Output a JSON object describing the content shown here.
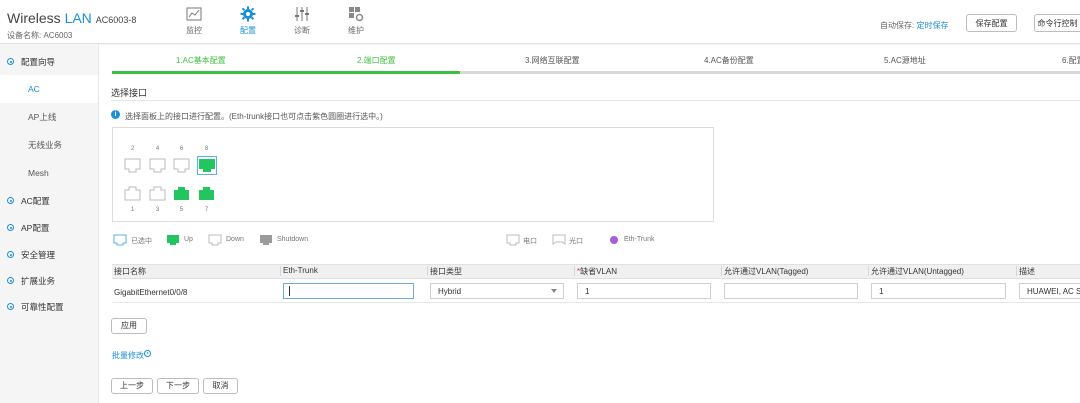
{
  "header": {
    "brand_wireless": "Wireless",
    "brand_lan": "LAN",
    "model": "AC6003-8",
    "device_label": "设备名称:",
    "device_name": "AC6003",
    "nav": [
      {
        "label": "监控",
        "icon": "monitor-chart-icon",
        "active": false
      },
      {
        "label": "配置",
        "icon": "gear-icon",
        "active": true
      },
      {
        "label": "诊断",
        "icon": "sliders-icon",
        "active": false
      },
      {
        "label": "维护",
        "icon": "maintenance-icon",
        "active": false
      }
    ],
    "autosave_label": "自动保存:",
    "autosave_link": "定时保存",
    "save_button": "保存配置",
    "cli_button": "命令行控制"
  },
  "sidebar": {
    "items": [
      {
        "label": "配置向导",
        "type": "group"
      },
      {
        "label": "AC",
        "type": "sub",
        "active": true
      },
      {
        "label": "AP上线",
        "type": "sub"
      },
      {
        "label": "无线业务",
        "type": "sub"
      },
      {
        "label": "Mesh",
        "type": "sub"
      },
      {
        "label": "AC配置",
        "type": "group"
      },
      {
        "label": "AP配置",
        "type": "group"
      },
      {
        "label": "安全管理",
        "type": "group"
      },
      {
        "label": "扩展业务",
        "type": "group"
      },
      {
        "label": "可靠性配置",
        "type": "group"
      }
    ]
  },
  "steps": [
    {
      "label": "1.AC基本配置",
      "done": true
    },
    {
      "label": "2.端口配置",
      "done": true
    },
    {
      "label": "3.网络互联配置",
      "done": false
    },
    {
      "label": "4.AC备份配置",
      "done": false
    },
    {
      "label": "5.AC源地址",
      "done": false
    },
    {
      "label": "6.配置",
      "done": false
    }
  ],
  "step_progress": 0.36,
  "section_title": "选择接口",
  "info_text": "选择面板上的接口进行配置。(Eth-trunk接口也可点击紫色圆圈进行选中。)",
  "ports": {
    "top": [
      {
        "num": "2",
        "state": "down"
      },
      {
        "num": "4",
        "state": "down"
      },
      {
        "num": "6",
        "state": "down"
      },
      {
        "num": "8",
        "state": "selected"
      }
    ],
    "bottom": [
      {
        "num": "1",
        "state": "down"
      },
      {
        "num": "3",
        "state": "down"
      },
      {
        "num": "5",
        "state": "up"
      },
      {
        "num": "7",
        "state": "up"
      }
    ]
  },
  "legend": {
    "selected": "已选中",
    "up": "Up",
    "down": "Down",
    "shutdown": "Shutdown",
    "electrical": "电口",
    "optical": "光口",
    "eth_trunk": "Eth-Trunk"
  },
  "colors": {
    "accent": "#1a90d8",
    "up": "#22c55e",
    "step_done": "#3fbf3f",
    "shutdown": "#9a9a9a",
    "eth_trunk": "#a35fe0"
  },
  "table": {
    "headers": [
      "接口名称",
      "Eth-Trunk",
      "接口类型",
      "缺省VLAN",
      "允许通过VLAN(Tagged)",
      "允许通过VLAN(Untagged)",
      "描述"
    ],
    "row": {
      "name": "GigabitEthernet0/0/8",
      "eth_trunk": "",
      "type": "Hybrid",
      "pvid": "1",
      "tagged": "",
      "untagged": "1",
      "desc": "HUAWEI, AC Se"
    }
  },
  "apply_button": "应用",
  "batch_modify": "批量修改",
  "prev_button": "上一步",
  "next_button": "下一步",
  "cancel_button": "取消"
}
